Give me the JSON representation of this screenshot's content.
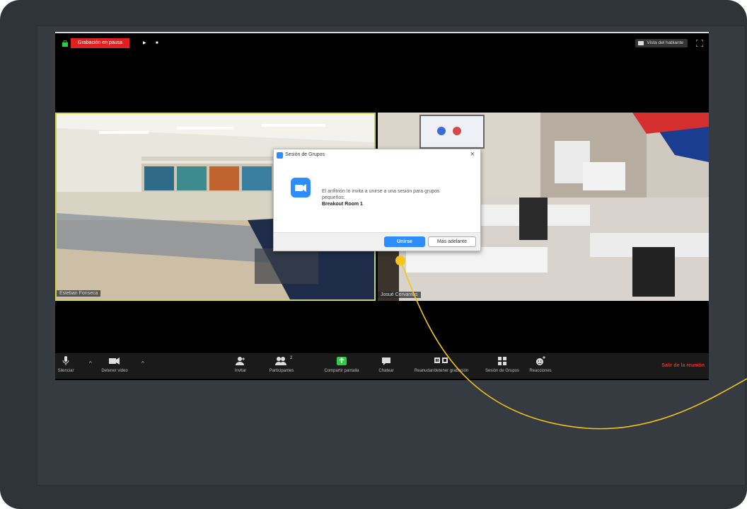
{
  "recording": {
    "status_label": "Grabación en pausa"
  },
  "view": {
    "speaker_view_label": "Vista del hablante"
  },
  "participants": [
    {
      "name": "Esteban Fonseca"
    },
    {
      "name": "Josué Cervantes"
    }
  ],
  "dialog": {
    "title": "Sesión de Grupos",
    "message": "El anfitrión lo invita a unirse a una sesión para grupos pequeños:",
    "room": "Breakout Room 1",
    "join_label": "Unirse",
    "later_label": "Más adelante"
  },
  "toolbar": {
    "mute_label": "Silenciar",
    "video_label": "Detener video",
    "invite_label": "Invitar",
    "participants_label": "Participantes",
    "participants_count": "2",
    "share_label": "Compartir pantalla",
    "chat_label": "Chatear",
    "record_label": "Reanudar/detener grabación",
    "breakout_label": "Sesión de Grupos",
    "reactions_label": "Reacciones",
    "leave_label": "Salir de la reunión"
  },
  "colors": {
    "accent": "#2d8cff",
    "recording": "#e02020",
    "leave": "#e0342b",
    "highlight_pointer": "#f5c518",
    "active_speaker_border": "#c9d64a"
  }
}
